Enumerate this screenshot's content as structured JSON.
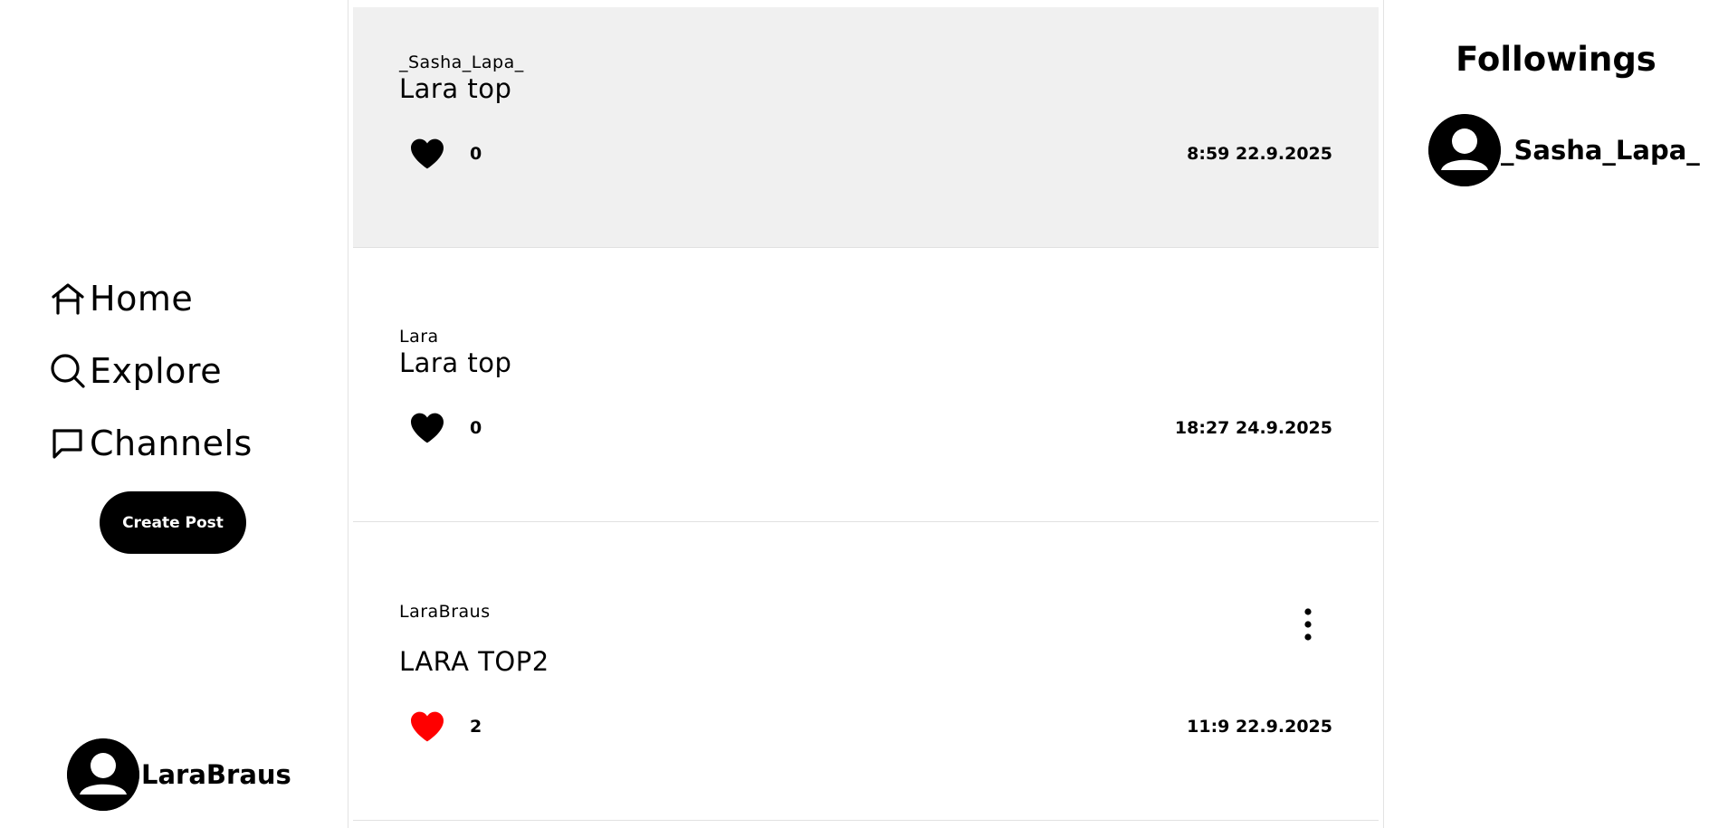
{
  "sidebar": {
    "nav": [
      {
        "label": "Home",
        "icon": "home-icon"
      },
      {
        "label": "Explore",
        "icon": "search-icon"
      },
      {
        "label": "Channels",
        "icon": "chat-bubble-icon"
      }
    ],
    "create_post_label": "Create Post",
    "current_user": {
      "name": "LaraBraus",
      "icon": "avatar-icon"
    }
  },
  "feed": {
    "posts": [
      {
        "author": "_Sasha_Lapa_",
        "text": "Lara top",
        "likes": "0",
        "liked": false,
        "time": "8:59 22.9.2025",
        "highlighted": true
      },
      {
        "author": "Lara",
        "text": "Lara top",
        "likes": "0",
        "liked": false,
        "time": "18:27 24.9.2025",
        "highlighted": false
      },
      {
        "author": "LaraBraus",
        "text": "LARA TOP2",
        "likes": "2",
        "liked": true,
        "time": "11:9 22.9.2025",
        "highlighted": false,
        "has_menu": true
      }
    ]
  },
  "followings": {
    "title": "Followings",
    "items": [
      {
        "name": "_Sasha_Lapa_",
        "icon": "avatar-icon"
      }
    ]
  },
  "colors": {
    "liked_heart": "#ff0000",
    "heart": "#000000",
    "highlight_bg": "#f0f0f0",
    "button_bg": "#000000"
  }
}
